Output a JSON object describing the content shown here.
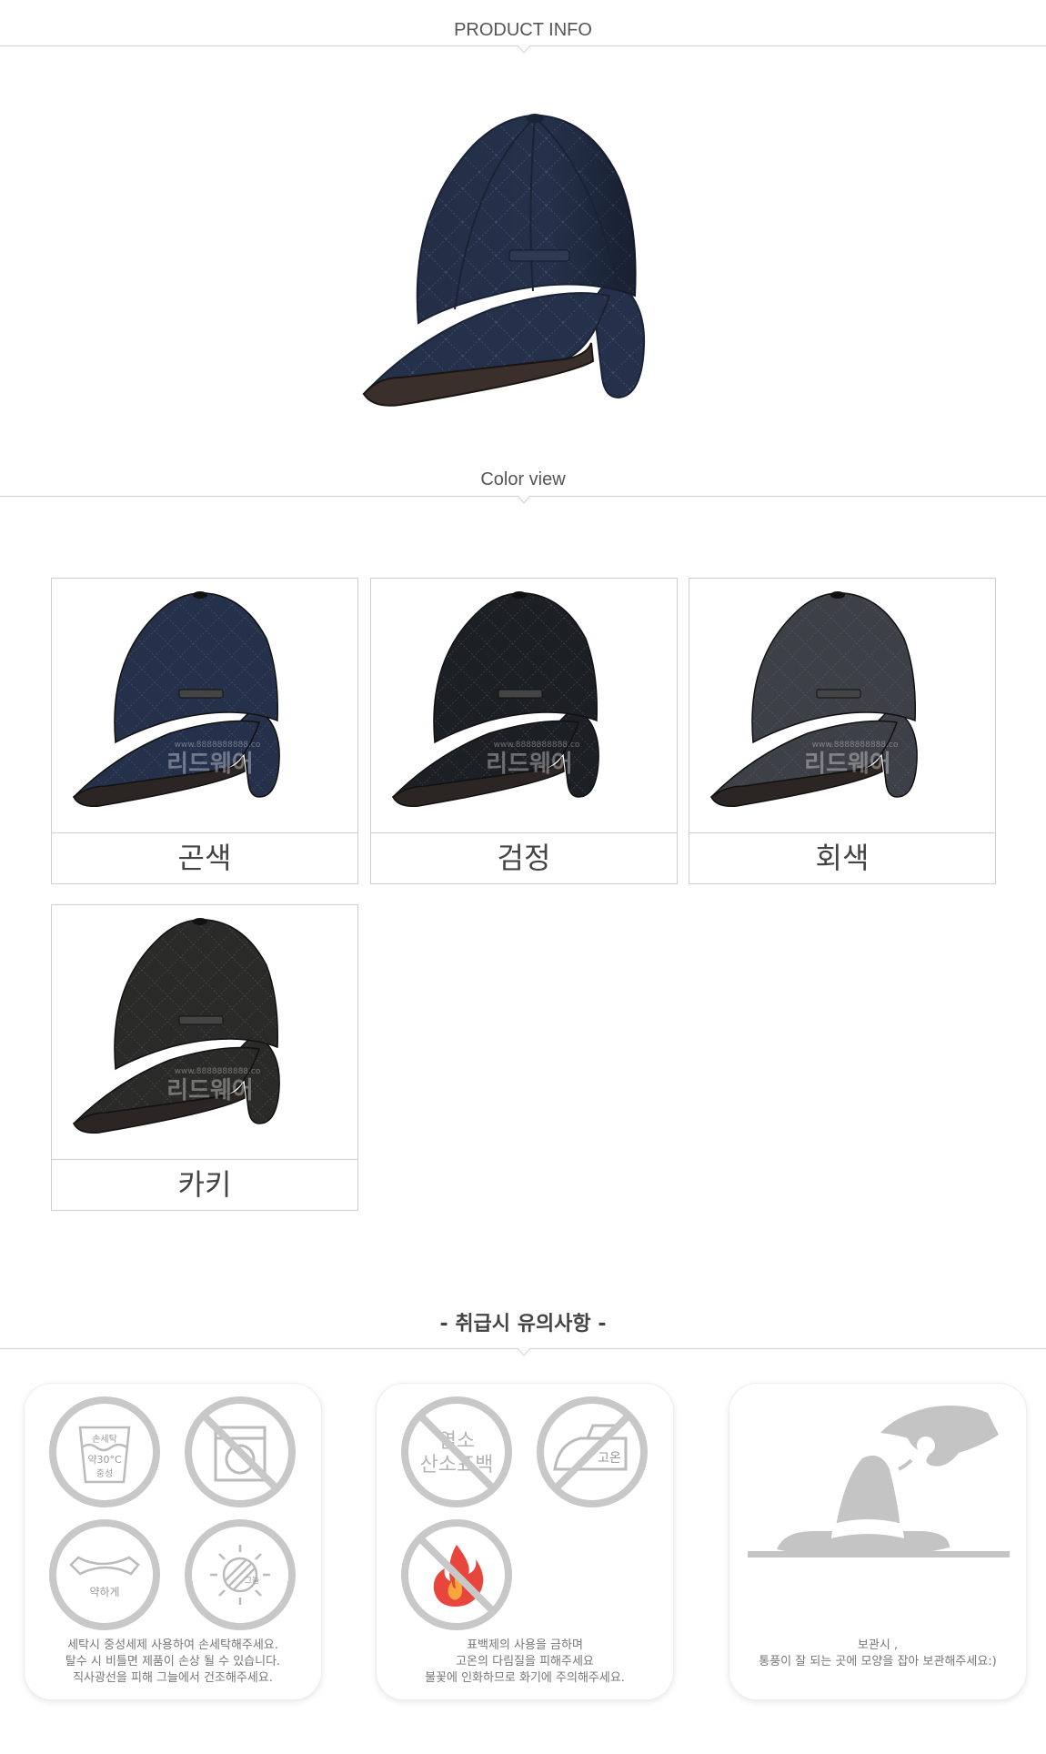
{
  "sections": {
    "product_info": "PRODUCT INFO",
    "color_view": "Color view",
    "care_title": "-  취급시 유의사항 -"
  },
  "colors": {
    "navy": "#25314a",
    "black": "#1c1f24",
    "gray": "#3d4046",
    "khaki": "#2a2a28",
    "rule": "#cfcfcf",
    "care_icon": "#c8c8c8",
    "flame": "#e8453c"
  },
  "color_options": [
    {
      "label": "곤색",
      "color_key": "navy"
    },
    {
      "label": "검정",
      "color_key": "black"
    },
    {
      "label": "회색",
      "color_key": "gray"
    },
    {
      "label": "카키",
      "color_key": "khaki"
    }
  ],
  "watermark": {
    "text": "리드웨어",
    "url": "www.8888888888.co"
  },
  "care": {
    "box1": {
      "icons": [
        {
          "name": "hand-wash-icon",
          "lines": [
            "손세탁",
            "약30°C",
            "중성"
          ]
        },
        {
          "name": "no-washing-machine-icon"
        },
        {
          "name": "gentle-wring-icon",
          "text": "약하게"
        },
        {
          "name": "shade-dry-icon",
          "text": "그늘"
        }
      ],
      "text": "세탁시 중성세제 사용하여 손세탁해주세요.\n탈수 시 비틀면 제품이 손상 될 수 있습니다.\n직사광선을 피해 그늘에서 건조해주세요."
    },
    "box2": {
      "icons": [
        {
          "name": "no-bleach-icon",
          "lines": [
            "염소",
            "산소표백"
          ]
        },
        {
          "name": "no-high-heat-iron-icon",
          "text": "고온"
        },
        {
          "name": "no-fire-icon"
        }
      ],
      "text": "표백제의 사용을 금하며\n고온의 다림질을 피해주세요\n불꽃에 인화하므로 화기에 주의해주세요."
    },
    "box3": {
      "icons": [
        {
          "name": "hat-storage-icon"
        }
      ],
      "text": "보관시 ,\n통풍이 잘 되는 곳에 모양을 잡아 보관해주세요:)"
    }
  }
}
